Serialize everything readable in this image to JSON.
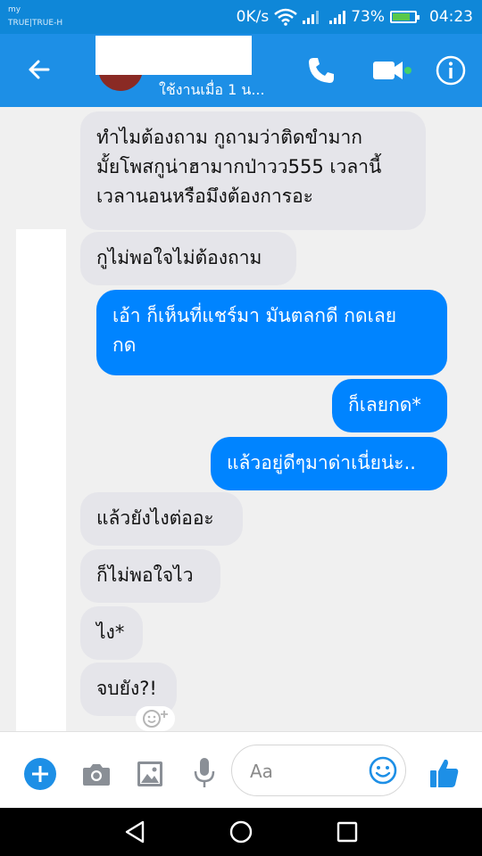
{
  "status_bar": {
    "carrier_top": "my",
    "carrier_bottom": "TRUE|TRUE-H",
    "speed": "0K/s",
    "battery": "73%",
    "time": "04:23"
  },
  "header": {
    "subtitle": "ใช้งานเมื่อ 1 น...",
    "accent_color": "#1d8fe6",
    "online_color": "#44d06a"
  },
  "messages": [
    {
      "side": "in",
      "text": "ทำไมต้องถาม กูถามว่าติดขำมาก\nมั้ยโพสกูน่าฮามากป่าวว555 เวลานี้\nเวลานอนหรือมึงต้องการอะ"
    },
    {
      "side": "in",
      "text": "กูไม่พอใจไม่ต้องถาม"
    },
    {
      "side": "out",
      "text": "เอ้า ก็เห็นที่แชร์มา มันตลกดี กดเลย\nกด"
    },
    {
      "side": "out",
      "text": "ก็เลยกด*"
    },
    {
      "side": "out",
      "text": "แล้วอยู่ดีๆมาด่าเนี่ยน่ะ.."
    },
    {
      "side": "in",
      "text": "แล้วยังไงต่ออะ"
    },
    {
      "side": "in",
      "text": "ก็ไม่พอใจไว"
    },
    {
      "side": "in",
      "text": "ไง*"
    },
    {
      "side": "in",
      "text": "จบยัง?!"
    }
  ],
  "composer": {
    "placeholder": "Aa"
  },
  "icons": [
    "back-arrow-icon",
    "phone-icon",
    "video-camera-icon",
    "info-icon",
    "plus-icon",
    "camera-icon",
    "image-icon",
    "microphone-icon",
    "emoji-icon",
    "thumbs-up-icon",
    "add-reaction-icon"
  ]
}
